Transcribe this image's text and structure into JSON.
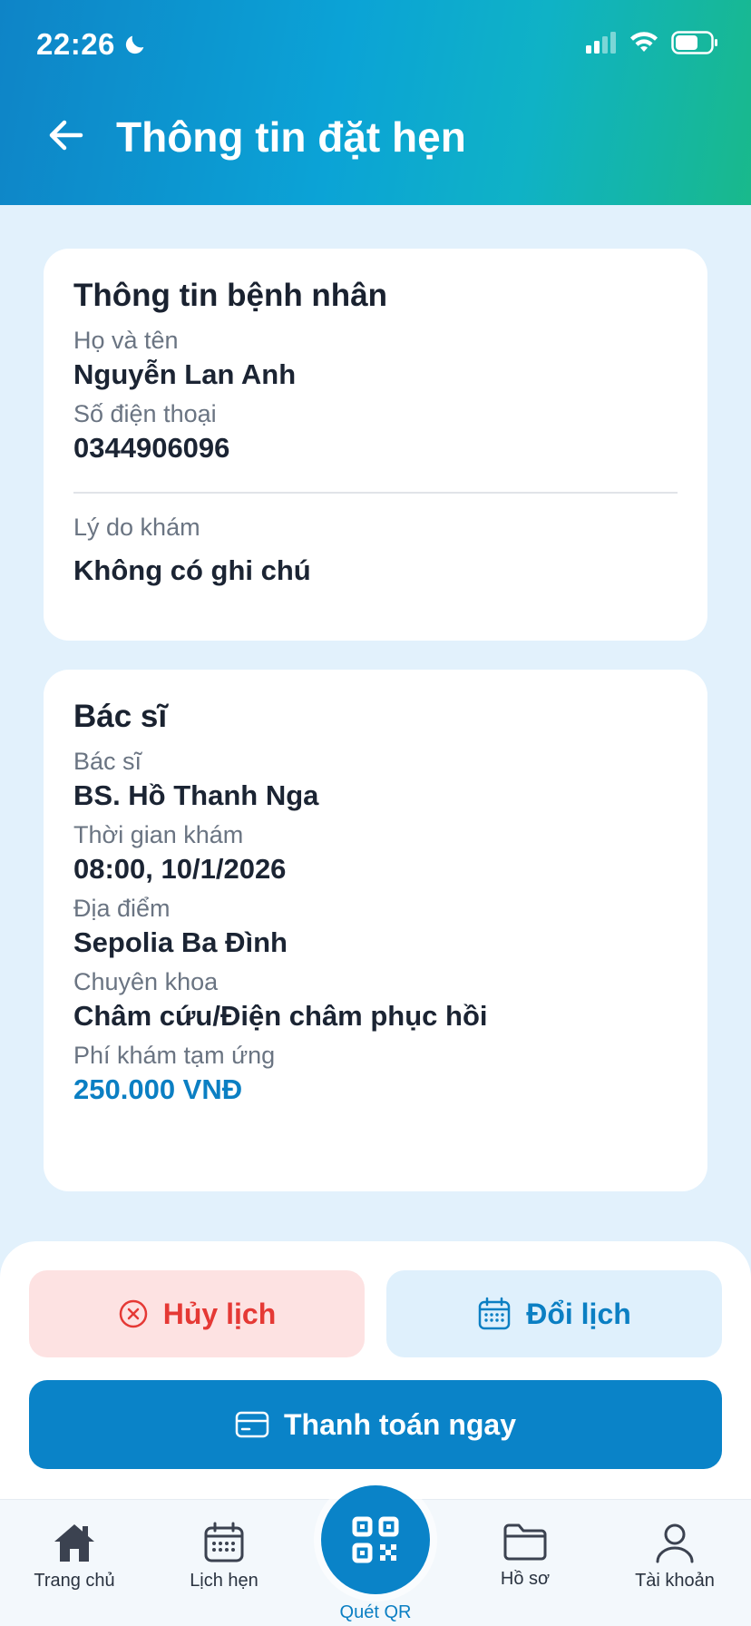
{
  "status": {
    "time": "22:26"
  },
  "header": {
    "title": "Thông tin đặt hẹn"
  },
  "patient": {
    "heading": "Thông tin bệnh nhân",
    "name_label": "Họ và tên",
    "name": "Nguyễn Lan Anh",
    "phone_label": "Số điện thoại",
    "phone": "0344906096",
    "reason_label": "Lý do khám",
    "reason": "Không có ghi chú"
  },
  "doctor": {
    "heading": "Bác sĩ",
    "doctor_label": "Bác sĩ",
    "doctor_name": "BS. Hồ Thanh Nga",
    "time_label": "Thời gian khám",
    "time": "08:00, 10/1/2026",
    "location_label": "Địa điểm",
    "location": "Sepolia Ba Đình",
    "specialty_label": "Chuyên khoa",
    "specialty": "Châm cứu/Điện châm phục hồi",
    "fee_label": "Phí khám tạm ứng",
    "fee": "250.000 VNĐ"
  },
  "actions": {
    "cancel": "Hủy lịch",
    "reschedule": "Đổi lịch",
    "pay": "Thanh toán ngay"
  },
  "tabs": {
    "home": "Trang chủ",
    "appointments": "Lịch hẹn",
    "scan": "Quét QR",
    "records": "Hồ sơ",
    "account": "Tài khoản"
  },
  "colors": {
    "primary": "#0a83c8",
    "danger": "#e53935",
    "danger_bg": "#fde2e2",
    "info_bg": "#dff0fc",
    "page_bg": "#e2f1fc"
  }
}
